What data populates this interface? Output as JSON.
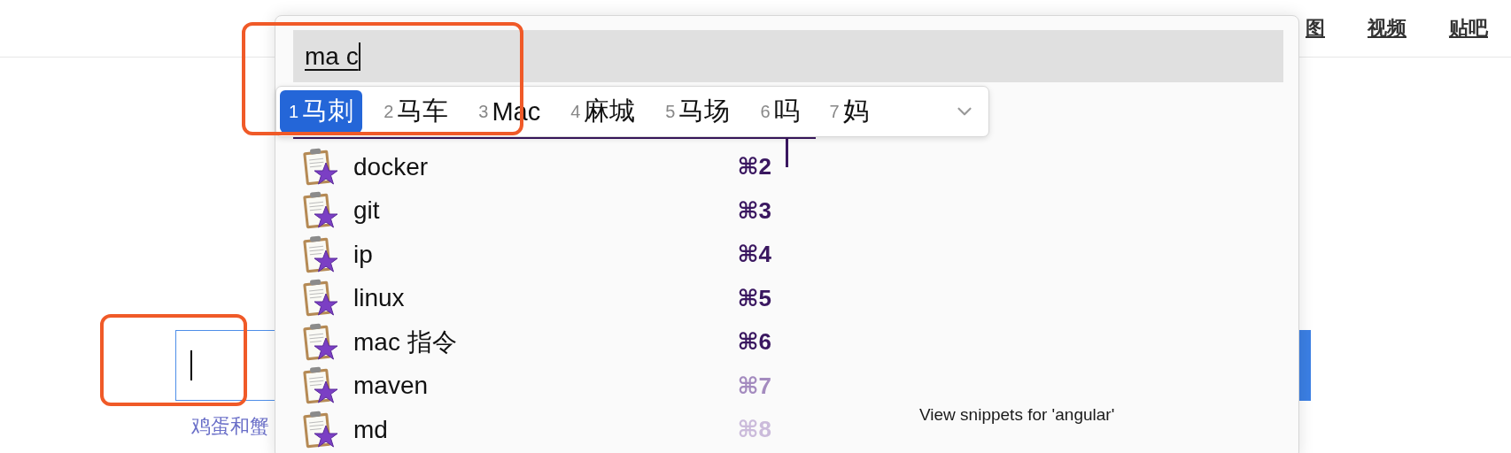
{
  "browser_page": {
    "nav_links": [
      "图",
      "视频",
      "贴吧"
    ],
    "suggestion": "鸡蛋和蟹"
  },
  "snippet_panel": {
    "query": "ma c",
    "candidates": [
      {
        "number": "1",
        "text": "马刺",
        "selected": true
      },
      {
        "number": "2",
        "text": "马车",
        "selected": false
      },
      {
        "number": "3",
        "text": "Mac",
        "selected": false
      },
      {
        "number": "4",
        "text": "麻城",
        "selected": false
      },
      {
        "number": "5",
        "text": "马场",
        "selected": false
      },
      {
        "number": "6",
        "text": "吗",
        "selected": false
      },
      {
        "number": "7",
        "text": "妈",
        "selected": false
      }
    ],
    "snippets": [
      {
        "name": "docker",
        "shortcut": "⌘2",
        "color": "#3a1760"
      },
      {
        "name": "git",
        "shortcut": "⌘3",
        "color": "#3a1760"
      },
      {
        "name": "ip",
        "shortcut": "⌘4",
        "color": "#3a1760"
      },
      {
        "name": "linux",
        "shortcut": "⌘5",
        "color": "#3a1760"
      },
      {
        "name": "mac 指令",
        "shortcut": "⌘6",
        "color": "#3a1760"
      },
      {
        "name": "maven",
        "shortcut": "⌘7",
        "color": "#a48bbf"
      },
      {
        "name": "md",
        "shortcut": "⌘8",
        "color": "#cbbbdb"
      }
    ],
    "footer": "View snippets for 'angular'"
  },
  "annotations": [
    {
      "kind": "frame"
    },
    {
      "kind": "frame"
    }
  ]
}
